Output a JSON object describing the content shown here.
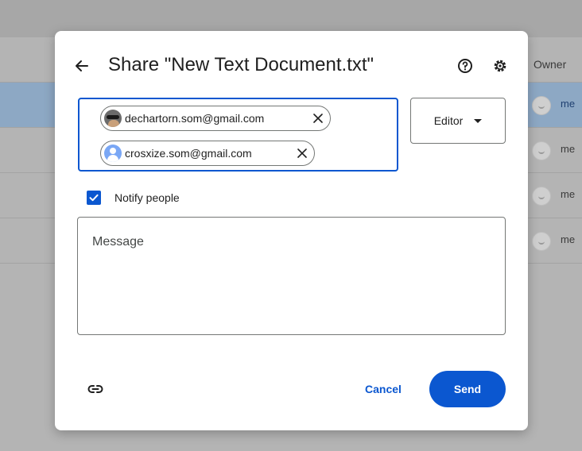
{
  "background": {
    "owner_header": "Owner",
    "rows": [
      {
        "owner": "me",
        "selected": true
      },
      {
        "owner": "me",
        "selected": false
      },
      {
        "owner": "me",
        "selected": false
      },
      {
        "owner": "me",
        "selected": false
      }
    ]
  },
  "dialog": {
    "title": "Share \"New Text Document.txt\"",
    "recipients": [
      {
        "email": "dechartorn.som@gmail.com",
        "avatar": "photo"
      },
      {
        "email": "crosxize.som@gmail.com",
        "avatar": "generic-person-icon"
      }
    ],
    "role": "Editor",
    "notify": {
      "label": "Notify people",
      "checked": true
    },
    "message_placeholder": "Message",
    "cancel_label": "Cancel",
    "send_label": "Send"
  },
  "colors": {
    "accent": "#0b57d0",
    "scrim": "#b4b4b4",
    "selected_row": "#8da8c4"
  }
}
